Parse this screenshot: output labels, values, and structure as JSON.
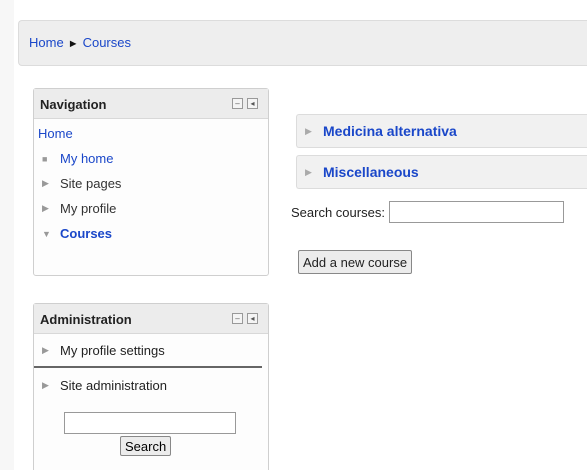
{
  "breadcrumb": {
    "home": "Home",
    "separator": "►",
    "current": "Courses"
  },
  "navigation_block": {
    "title": "Navigation",
    "home": "Home",
    "items": [
      {
        "label": "My home",
        "icon": "bullet-icon"
      },
      {
        "label": "Site pages",
        "icon": "triangle-right-icon"
      },
      {
        "label": "My profile",
        "icon": "triangle-right-icon"
      },
      {
        "label": "Courses",
        "icon": "triangle-down-icon"
      }
    ]
  },
  "administration_block": {
    "title": "Administration",
    "items": [
      {
        "label": "My profile settings"
      },
      {
        "label": "Site administration"
      }
    ],
    "search_button": "Search",
    "search_value": ""
  },
  "main": {
    "categories": [
      "Medicina alternativa",
      "Miscellaneous"
    ],
    "search_label": "Search courses:",
    "search_value": "",
    "add_course_button": "Add a new course"
  },
  "colors": {
    "link": "#1a47c9",
    "header_bg": "#ececec"
  }
}
